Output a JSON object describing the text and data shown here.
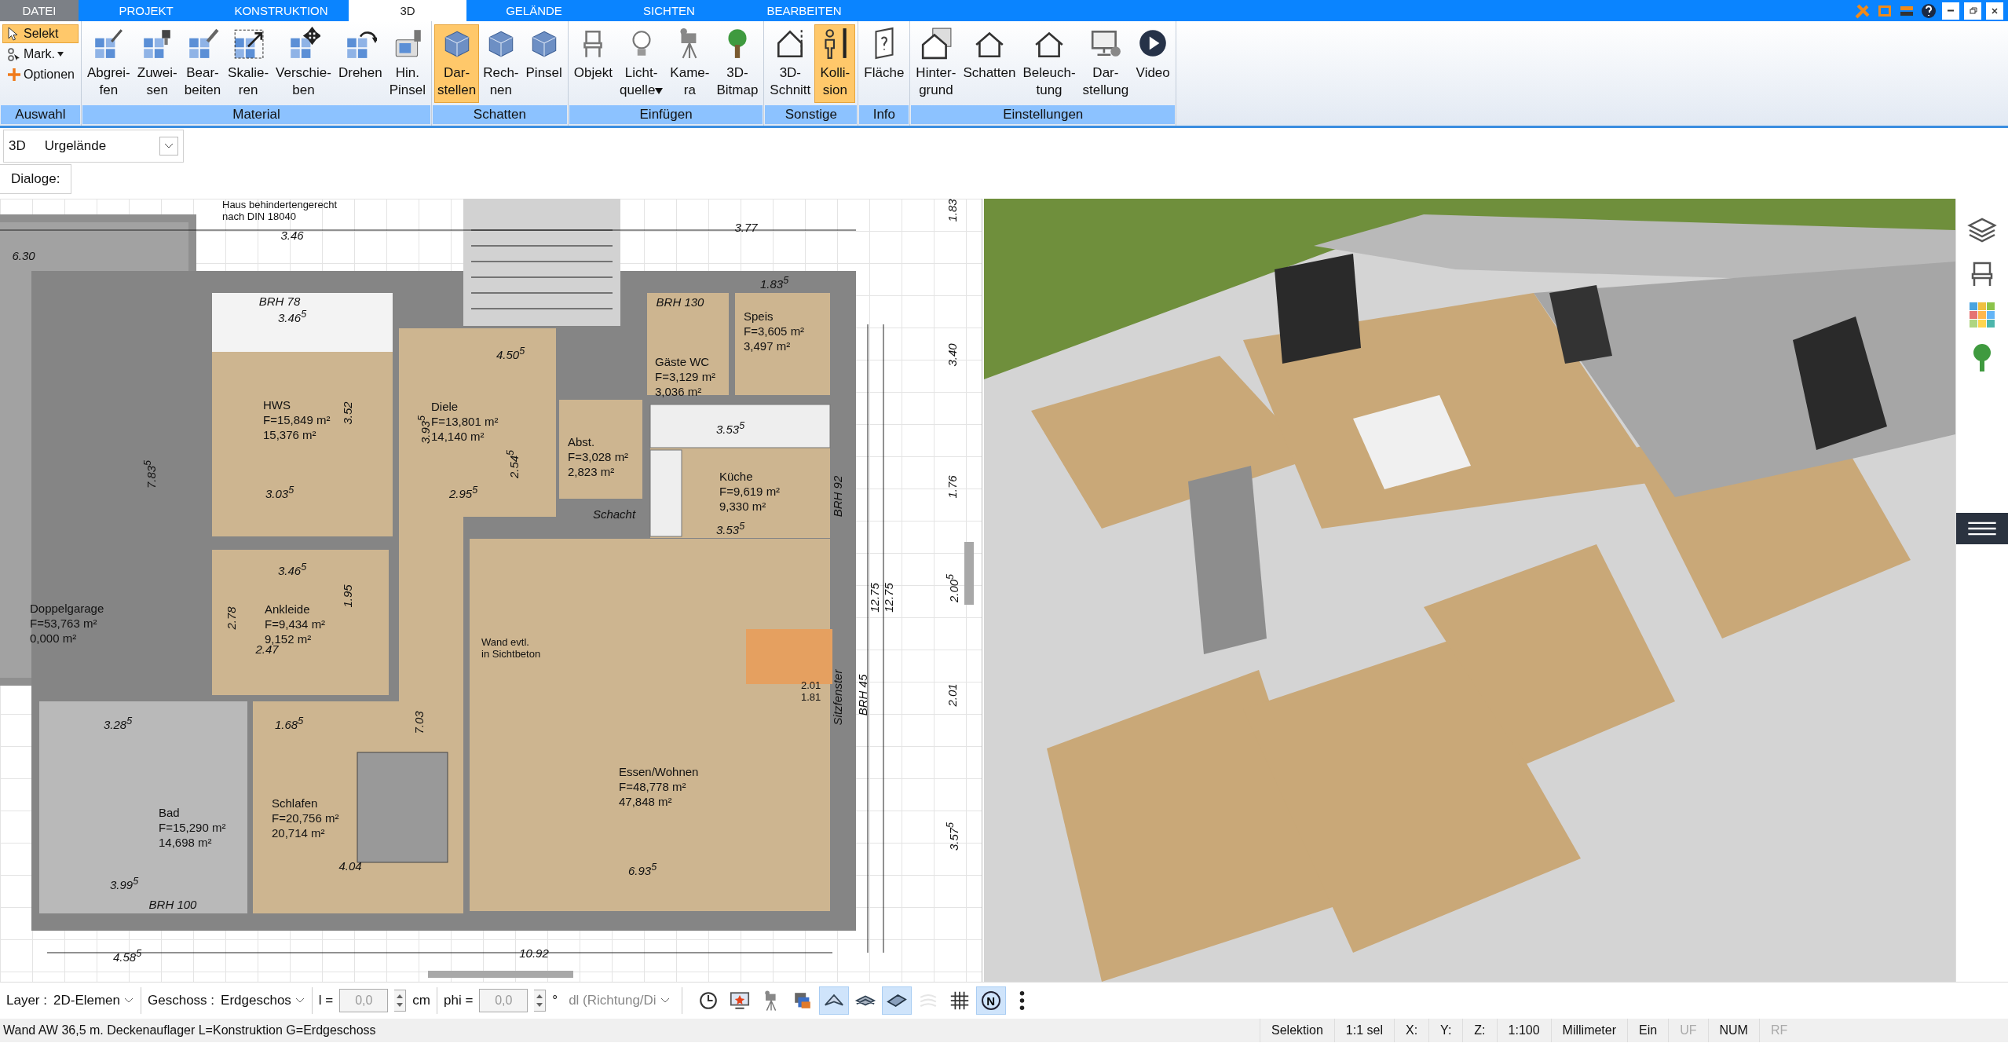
{
  "tabs": [
    {
      "label": "DATEI",
      "kind": "file",
      "selected": false
    },
    {
      "label": "PROJEKT",
      "kind": "tab",
      "selected": false
    },
    {
      "label": "KONSTRUKTION",
      "kind": "tab",
      "selected": false
    },
    {
      "label": "3D",
      "kind": "tab",
      "selected": true
    },
    {
      "label": "GELÄNDE",
      "kind": "tab",
      "selected": false
    },
    {
      "label": "SICHTEN",
      "kind": "tab",
      "selected": false
    },
    {
      "label": "BEARBEITEN",
      "kind": "tab",
      "selected": false
    }
  ],
  "ribbon": {
    "groups": [
      {
        "label": "Auswahl",
        "items": [
          {
            "kind": "small",
            "label": "Selekt",
            "selected": true,
            "dropdown": false
          },
          {
            "kind": "small",
            "label": "Mark.",
            "selected": false,
            "dropdown": true
          },
          {
            "kind": "small",
            "label": "Optionen",
            "selected": false,
            "dropdown": false
          }
        ]
      },
      {
        "label": "Material",
        "items": [
          {
            "kind": "large",
            "label": "Abgrei-\nfen",
            "selected": false,
            "dropdown": false
          },
          {
            "kind": "large",
            "label": "Zuwei-\nsen",
            "selected": false,
            "dropdown": false
          },
          {
            "kind": "large",
            "label": "Bear-\nbeiten",
            "selected": false,
            "dropdown": false
          },
          {
            "kind": "large",
            "label": "Skalie-\nren",
            "selected": false,
            "dropdown": false
          },
          {
            "kind": "large",
            "label": "Verschie-\nben",
            "selected": false,
            "dropdown": false
          },
          {
            "kind": "large",
            "label": "Drehen",
            "selected": false,
            "dropdown": false
          },
          {
            "kind": "large",
            "label": "Hin.\nPinsel",
            "selected": false,
            "dropdown": false
          }
        ]
      },
      {
        "label": "Schatten",
        "items": [
          {
            "kind": "large",
            "label": "Dar-\nstellen",
            "selected": true,
            "dropdown": false
          },
          {
            "kind": "large",
            "label": "Rech-\nnen",
            "selected": false,
            "dropdown": false
          },
          {
            "kind": "large",
            "label": "Pinsel",
            "selected": false,
            "dropdown": false
          }
        ]
      },
      {
        "label": "Einfügen",
        "items": [
          {
            "kind": "large",
            "label": "Objekt",
            "selected": false,
            "dropdown": false
          },
          {
            "kind": "large",
            "label": "Licht-\nquelle",
            "selected": false,
            "dropdown": true
          },
          {
            "kind": "large",
            "label": "Kame-\nra",
            "selected": false,
            "dropdown": false
          },
          {
            "kind": "large",
            "label": "3D-\nBitmap",
            "selected": false,
            "dropdown": false
          }
        ]
      },
      {
        "label": "Sonstige",
        "items": [
          {
            "kind": "large",
            "label": "3D-\nSchnitt",
            "selected": false,
            "dropdown": false
          },
          {
            "kind": "large",
            "label": "Kolli-\nsion",
            "selected": true,
            "dropdown": false
          }
        ]
      },
      {
        "label": "Info",
        "items": [
          {
            "kind": "large",
            "label": "Fläche",
            "selected": false,
            "dropdown": false
          }
        ]
      },
      {
        "label": "Einstellungen",
        "items": [
          {
            "kind": "large",
            "label": "Hinter-\ngrund",
            "selected": false,
            "dropdown": false
          },
          {
            "kind": "large",
            "label": "Schatten",
            "selected": false,
            "dropdown": false
          },
          {
            "kind": "large",
            "label": "Beleuch-\ntung",
            "selected": false,
            "dropdown": false
          },
          {
            "kind": "large",
            "label": "Dar-\nstellung",
            "selected": false,
            "dropdown": false
          },
          {
            "kind": "large",
            "label": "Video",
            "selected": false,
            "dropdown": false
          }
        ]
      }
    ]
  },
  "view_bar": {
    "label": "3D",
    "value": "Urgelände"
  },
  "dialog_bar": {
    "label": "Dialoge:"
  },
  "floor_plan": {
    "labels": [
      {
        "kind": "note",
        "text": "Haus behindertengerecht\nnach DIN 18040"
      },
      {
        "kind": "dim",
        "text": "3.46"
      },
      {
        "kind": "dim",
        "text": "6.30"
      },
      {
        "kind": "vdim",
        "text": "7.83$^{5}$"
      },
      {
        "kind": "room",
        "name": "Doppelgarage",
        "area": "F=53,763 m²",
        "net": "0,000 m²"
      },
      {
        "kind": "dim",
        "text": "BRH 78"
      },
      {
        "kind": "dim",
        "text": "3.46$^{5}$"
      },
      {
        "kind": "room",
        "name": "HWS",
        "area": "F=15,849 m²",
        "net": "15,376 m²"
      },
      {
        "kind": "dim",
        "text": "3.03$^{5}$"
      },
      {
        "kind": "vdim",
        "text": "3.52"
      },
      {
        "kind": "dim",
        "text": "3.46$^{5}$"
      },
      {
        "kind": "room",
        "name": "Ankleide",
        "area": "F=9,434 m²",
        "net": "9,152 m²"
      },
      {
        "kind": "vdim",
        "text": "2.78"
      },
      {
        "kind": "dim",
        "text": "2.47"
      },
      {
        "kind": "vdim",
        "text": "1.95"
      },
      {
        "kind": "dim",
        "text": "3.28$^{5}$"
      },
      {
        "kind": "room",
        "name": "Bad",
        "area": "F=15,290 m²",
        "net": "14,698 m²"
      },
      {
        "kind": "dim",
        "text": "3.99$^{5}$"
      },
      {
        "kind": "dim",
        "text": "BRH 100"
      },
      {
        "kind": "dim",
        "text": "1.68$^{5}$"
      },
      {
        "kind": "vdim",
        "text": "7.03"
      },
      {
        "kind": "room",
        "name": "Schlafen",
        "area": "F=20,756 m²",
        "net": "20,714 m²"
      },
      {
        "kind": "dim",
        "text": "4.04"
      },
      {
        "kind": "dim",
        "text": "4.58$^{5}$"
      },
      {
        "kind": "dim",
        "text": "4.50$^{5}$"
      },
      {
        "kind": "room",
        "name": "Diele",
        "area": "F=13,801 m²",
        "net": "14,140 m²"
      },
      {
        "kind": "vdim",
        "text": "3.93$^{5}$"
      },
      {
        "kind": "dim",
        "text": "2.95$^{5}$"
      },
      {
        "kind": "vdim",
        "text": "2.54$^{5}$"
      },
      {
        "kind": "room",
        "name": "Abst.",
        "area": "F=3,028 m²",
        "net": "2,823 m²"
      },
      {
        "kind": "dim",
        "text": "BRH 130"
      },
      {
        "kind": "room",
        "name": "Gäste WC",
        "area": "F=3,129 m²",
        "net": "3,036 m²"
      },
      {
        "kind": "dim",
        "text": "1.83$^{5}$"
      },
      {
        "kind": "room",
        "name": "Speis",
        "area": "F=3,605 m²",
        "net": "3,497 m²"
      },
      {
        "kind": "dim",
        "text": "3.77"
      },
      {
        "kind": "dim",
        "text": "3.53$^{5}$"
      },
      {
        "kind": "room",
        "name": "Küche",
        "area": "F=9,619 m²",
        "net": "9,330 m²"
      },
      {
        "kind": "dim",
        "text": "3.53$^{5}$"
      },
      {
        "kind": "vdim",
        "text": "BRH 92"
      },
      {
        "kind": "dim",
        "text": "Schacht"
      },
      {
        "kind": "note",
        "text": "Wand evtl.\nin Sichtbeton"
      },
      {
        "kind": "room",
        "name": "Essen/Wohnen",
        "area": "F=48,778 m²",
        "net": "47,848 m²"
      },
      {
        "kind": "dim",
        "text": "6.93$^{5}$"
      },
      {
        "kind": "dim",
        "text": "10.92"
      },
      {
        "kind": "vdim",
        "text": "Sitzfenster"
      },
      {
        "kind": "vdim",
        "text": "BRH 45"
      },
      {
        "kind": "note",
        "text": "2.01\n1.81"
      },
      {
        "kind": "vdim",
        "text": "1.83"
      },
      {
        "kind": "vdim",
        "text": "3.40"
      },
      {
        "kind": "vdim",
        "text": "1.76"
      },
      {
        "kind": "vdim",
        "text": "2.00$^{5}$"
      },
      {
        "kind": "vdim",
        "text": "2.01"
      },
      {
        "kind": "vdim",
        "text": "3.57$^{5}$"
      },
      {
        "kind": "vdim",
        "text": "12.75"
      },
      {
        "kind": "vdim",
        "text": "12.75"
      }
    ]
  },
  "bottom_toolbar": {
    "layer_label": "Layer :",
    "layer_value": "2D-Elemen",
    "floor_label": "Geschoss :",
    "floor_value": "Erdgeschos",
    "length_label": "l =",
    "length_value": "0,0",
    "length_unit": "cm",
    "angle_label": "phi =",
    "angle_value": "0,0",
    "angle_unit": "°",
    "direction_value": "dl (Richtung/Di",
    "fields_disabled": true,
    "tools": [
      {
        "kind": "icon",
        "selected": false,
        "disabled": false
      },
      {
        "kind": "icon",
        "selected": false,
        "disabled": false
      },
      {
        "kind": "icon",
        "selected": false,
        "disabled": false
      },
      {
        "kind": "icon",
        "selected": false,
        "disabled": false
      },
      {
        "kind": "icon",
        "selected": true,
        "disabled": false
      },
      {
        "kind": "icon",
        "selected": false,
        "disabled": false
      },
      {
        "kind": "icon",
        "selected": true,
        "disabled": false
      },
      {
        "kind": "icon",
        "selected": false,
        "disabled": true
      },
      {
        "kind": "icon",
        "selected": false,
        "disabled": false
      },
      {
        "kind": "text",
        "label": "N",
        "selected": true,
        "disabled": false
      },
      {
        "kind": "icon",
        "selected": false,
        "disabled": false
      }
    ]
  },
  "status_bar": {
    "message": "Wand AW 36,5 m. Deckenauflager L=Konstruktion G=Erdgeschoss",
    "cells": [
      {
        "text": "Selektion",
        "disabled": false
      },
      {
        "text": "1:1 sel",
        "disabled": false
      },
      {
        "text": "X:",
        "disabled": false
      },
      {
        "text": "Y:",
        "disabled": false
      },
      {
        "text": "Z:",
        "disabled": false
      },
      {
        "text": "1:100",
        "disabled": false
      },
      {
        "text": "Millimeter",
        "disabled": false
      },
      {
        "text": "Ein",
        "disabled": false
      },
      {
        "text": "UF",
        "disabled": true
      },
      {
        "text": "NUM",
        "disabled": false
      },
      {
        "text": "RF",
        "disabled": true
      }
    ]
  }
}
